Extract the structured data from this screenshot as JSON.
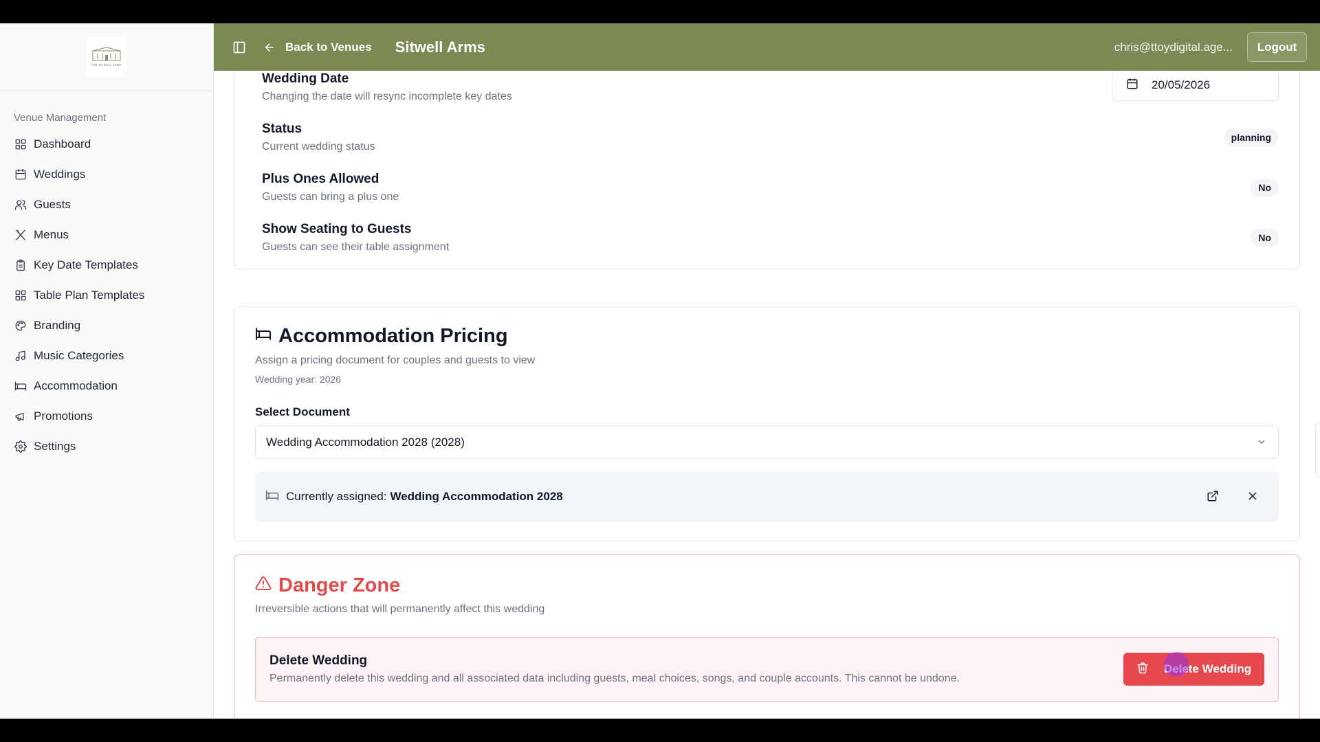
{
  "header": {
    "back_label": "Back to Venues",
    "venue_title": "Sitwell Arms",
    "user_email": "chris@ttoydigital.age...",
    "logout_label": "Logout"
  },
  "sidebar": {
    "logo_text": "THE SITWELL ARMS",
    "group_label": "Venue Management",
    "items": [
      {
        "label": "Dashboard",
        "icon": "layout-grid-icon"
      },
      {
        "label": "Weddings",
        "icon": "calendar-icon"
      },
      {
        "label": "Guests",
        "icon": "users-icon"
      },
      {
        "label": "Menus",
        "icon": "utensils-icon"
      },
      {
        "label": "Key Date Templates",
        "icon": "clipboard-icon"
      },
      {
        "label": "Table Plan Templates",
        "icon": "layout-grid-icon"
      },
      {
        "label": "Branding",
        "icon": "palette-icon"
      },
      {
        "label": "Music Categories",
        "icon": "music-icon"
      },
      {
        "label": "Accommodation",
        "icon": "bed-icon"
      },
      {
        "label": "Promotions",
        "icon": "megaphone-icon"
      },
      {
        "label": "Settings",
        "icon": "gear-icon"
      }
    ]
  },
  "settings": {
    "wedding_date": {
      "title": "Wedding Date",
      "subtitle": "Changing the date will resync incomplete key dates",
      "value": "20/05/2026"
    },
    "status": {
      "title": "Status",
      "subtitle": "Current wedding status",
      "value": "planning"
    },
    "plus_ones": {
      "title": "Plus Ones Allowed",
      "subtitle": "Guests can bring a plus one",
      "value": "No"
    },
    "seating": {
      "title": "Show Seating to Guests",
      "subtitle": "Guests can see their table assignment",
      "value": "No"
    }
  },
  "accommodation": {
    "title": "Accommodation Pricing",
    "subtitle": "Assign a pricing document for couples and guests to view",
    "wedding_year": "Wedding year: 2026",
    "select_label": "Select Document",
    "selected_value": "Wedding Accommodation 2028 (2028)",
    "assigned_prefix": "Currently assigned:",
    "assigned_name": "Wedding Accommodation 2028"
  },
  "danger": {
    "title": "Danger Zone",
    "subtitle": "Irreversible actions that will permanently affect this wedding",
    "delete_title": "Delete Wedding",
    "delete_desc": "Permanently delete this wedding and all associated data including guests, meal choices, songs, and couple accounts. This cannot be undone.",
    "delete_button": "Delete Wedding"
  },
  "colors": {
    "header_bg": "#7a8a52",
    "danger": "#e5484d",
    "cursor": "#9333ea"
  }
}
